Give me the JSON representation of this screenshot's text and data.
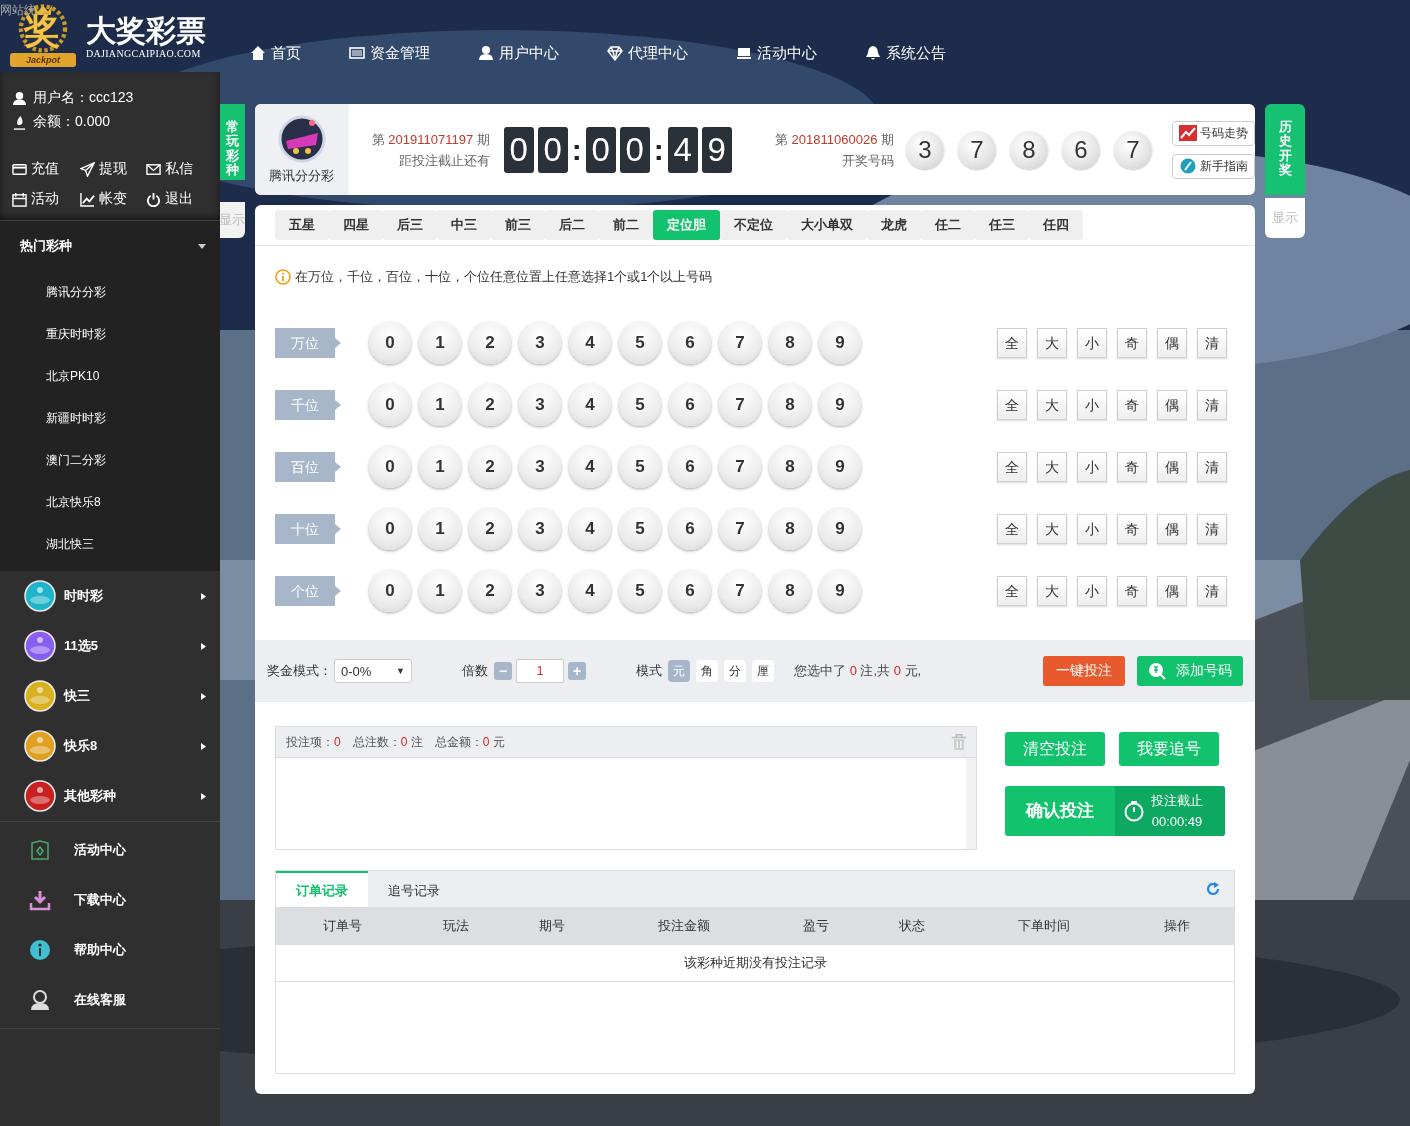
{
  "site_stat": "网站统",
  "logo": {
    "mark": "奖",
    "badge": "Jackpot",
    "title": "大奖彩票",
    "domain": "DAJIANGCAIPIAO.COM"
  },
  "nav": [
    {
      "label": "首页"
    },
    {
      "label": "资金管理"
    },
    {
      "label": "用户中心"
    },
    {
      "label": "代理中心"
    },
    {
      "label": "活动中心"
    },
    {
      "label": "系统公告"
    }
  ],
  "user": {
    "username": "用户名：ccc123",
    "balance": "余额：0.000"
  },
  "user_actions": [
    {
      "label": "充值"
    },
    {
      "label": "提现"
    },
    {
      "label": "私信"
    },
    {
      "label": "活动"
    },
    {
      "label": "帐变"
    },
    {
      "label": "退出"
    }
  ],
  "hot": {
    "title": "热门彩种",
    "expanded": true,
    "items": [
      "腾讯分分彩",
      "重庆时时彩",
      "北京PK10",
      "新疆时时彩",
      "澳门二分彩",
      "北京快乐8",
      "湖北快三"
    ]
  },
  "categories": [
    {
      "label": "时时彩",
      "color": "#1fb5c9"
    },
    {
      "label": "11选5",
      "color": "#8a5ef0"
    },
    {
      "label": "快三",
      "color": "#d8b020"
    },
    {
      "label": "快乐8",
      "color": "#e0a020"
    },
    {
      "label": "其他彩种",
      "color": "#c8201e"
    }
  ],
  "links": [
    {
      "label": "活动中心"
    },
    {
      "label": "下载中心"
    },
    {
      "label": "帮助中心"
    },
    {
      "label": "在线客服"
    }
  ],
  "left_tab": {
    "title": "常玩彩种",
    "toggle": "显示"
  },
  "right_tab": {
    "title": "历史开奖",
    "toggle": "显示"
  },
  "game": {
    "name": "腾讯分分彩",
    "issue_prefix": "第",
    "issue": "201911071197",
    "issue_suffix": "期",
    "countdown_label": "距投注截止还有",
    "countdown": [
      {
        "kind": "digit",
        "text": "0"
      },
      {
        "kind": "digit",
        "text": "0"
      },
      {
        "kind": "sep",
        "text": ":"
      },
      {
        "kind": "digit",
        "text": "0"
      },
      {
        "kind": "digit",
        "text": "0"
      },
      {
        "kind": "sep",
        "text": ":"
      },
      {
        "kind": "digit",
        "text": "4"
      },
      {
        "kind": "digit",
        "text": "9"
      }
    ]
  },
  "last_draw": {
    "issue_prefix": "第",
    "issue": "201811060026",
    "issue_suffix": "期",
    "label": "开奖号码",
    "balls": [
      "3",
      "7",
      "8",
      "6",
      "7"
    ]
  },
  "header_buttons": [
    {
      "label": "号码走势"
    },
    {
      "label": "新手指南"
    }
  ],
  "play_tabs": [
    {
      "label": "五星",
      "selected": false
    },
    {
      "label": "四星",
      "selected": false
    },
    {
      "label": "后三",
      "selected": false
    },
    {
      "label": "中三",
      "selected": false
    },
    {
      "label": "前三",
      "selected": false
    },
    {
      "label": "后二",
      "selected": false
    },
    {
      "label": "前二",
      "selected": false
    },
    {
      "label": "定位胆",
      "selected": true
    },
    {
      "label": "不定位",
      "selected": false
    },
    {
      "label": "大小单双",
      "selected": false
    },
    {
      "label": "龙虎",
      "selected": false
    },
    {
      "label": "任二",
      "selected": false
    },
    {
      "label": "任三",
      "selected": false
    },
    {
      "label": "任四",
      "selected": false
    }
  ],
  "hint": "在万位，千位，百位，十位，个位任意位置上任意选择1个或1个以上号码",
  "positions": [
    {
      "label": "万位",
      "numbers": [
        {
          "n": "0",
          "selected": false
        },
        {
          "n": "1",
          "selected": false
        },
        {
          "n": "2",
          "selected": false
        },
        {
          "n": "3",
          "selected": false
        },
        {
          "n": "4",
          "selected": false
        },
        {
          "n": "5",
          "selected": false
        },
        {
          "n": "6",
          "selected": false
        },
        {
          "n": "7",
          "selected": false
        },
        {
          "n": "8",
          "selected": false
        },
        {
          "n": "9",
          "selected": false
        }
      ],
      "quick": [
        "全",
        "大",
        "小",
        "奇",
        "偶",
        "清"
      ]
    },
    {
      "label": "千位",
      "numbers": [
        {
          "n": "0",
          "selected": false
        },
        {
          "n": "1",
          "selected": false
        },
        {
          "n": "2",
          "selected": false
        },
        {
          "n": "3",
          "selected": false
        },
        {
          "n": "4",
          "selected": false
        },
        {
          "n": "5",
          "selected": false
        },
        {
          "n": "6",
          "selected": false
        },
        {
          "n": "7",
          "selected": false
        },
        {
          "n": "8",
          "selected": false
        },
        {
          "n": "9",
          "selected": false
        }
      ],
      "quick": [
        "全",
        "大",
        "小",
        "奇",
        "偶",
        "清"
      ]
    },
    {
      "label": "百位",
      "numbers": [
        {
          "n": "0",
          "selected": false
        },
        {
          "n": "1",
          "selected": false
        },
        {
          "n": "2",
          "selected": false
        },
        {
          "n": "3",
          "selected": false
        },
        {
          "n": "4",
          "selected": false
        },
        {
          "n": "5",
          "selected": false
        },
        {
          "n": "6",
          "selected": false
        },
        {
          "n": "7",
          "selected": false
        },
        {
          "n": "8",
          "selected": false
        },
        {
          "n": "9",
          "selected": false
        }
      ],
      "quick": [
        "全",
        "大",
        "小",
        "奇",
        "偶",
        "清"
      ]
    },
    {
      "label": "十位",
      "numbers": [
        {
          "n": "0",
          "selected": false
        },
        {
          "n": "1",
          "selected": false
        },
        {
          "n": "2",
          "selected": false
        },
        {
          "n": "3",
          "selected": false
        },
        {
          "n": "4",
          "selected": false
        },
        {
          "n": "5",
          "selected": false
        },
        {
          "n": "6",
          "selected": false
        },
        {
          "n": "7",
          "selected": false
        },
        {
          "n": "8",
          "selected": false
        },
        {
          "n": "9",
          "selected": false
        }
      ],
      "quick": [
        "全",
        "大",
        "小",
        "奇",
        "偶",
        "清"
      ]
    },
    {
      "label": "个位",
      "numbers": [
        {
          "n": "0",
          "selected": false
        },
        {
          "n": "1",
          "selected": false
        },
        {
          "n": "2",
          "selected": false
        },
        {
          "n": "3",
          "selected": false
        },
        {
          "n": "4",
          "selected": false
        },
        {
          "n": "5",
          "selected": false
        },
        {
          "n": "6",
          "selected": false
        },
        {
          "n": "7",
          "selected": false
        },
        {
          "n": "8",
          "selected": false
        },
        {
          "n": "9",
          "selected": false
        }
      ],
      "quick": [
        "全",
        "大",
        "小",
        "奇",
        "偶",
        "清"
      ]
    }
  ],
  "bet_bar": {
    "prize_label": "奖金模式：",
    "prize_value": "0-0%",
    "prize_caret": "▼",
    "multiple_label": "倍数",
    "minus": "−",
    "multiple": "1",
    "plus": "+",
    "mode_label": "模式",
    "units": [
      {
        "label": "元",
        "selected": true
      },
      {
        "label": "角",
        "selected": false
      },
      {
        "label": "分",
        "selected": false
      },
      {
        "label": "厘",
        "selected": false
      }
    ],
    "summary": "您选中了 **0** 注,共 **0** 元,",
    "quick_bet": "一键投注",
    "add": "添加号码"
  },
  "cart": {
    "summary": "投注项：**0**　总注数：**0** 注　总金额：**0** 元"
  },
  "actions": {
    "clear": "清空投注",
    "chase": "我要追号",
    "confirm": "确认投注",
    "deadline_label": "投注截止",
    "deadline": "00:00:49"
  },
  "records": {
    "tabs": [
      {
        "label": "订单记录",
        "selected": true
      },
      {
        "label": "追号记录",
        "selected": false
      }
    ],
    "columns": [
      "订单号",
      "玩法",
      "期号",
      "投注金额",
      "盈亏",
      "状态",
      "下单时间",
      "操作"
    ],
    "empty": "该彩种近期没有投注记录"
  }
}
